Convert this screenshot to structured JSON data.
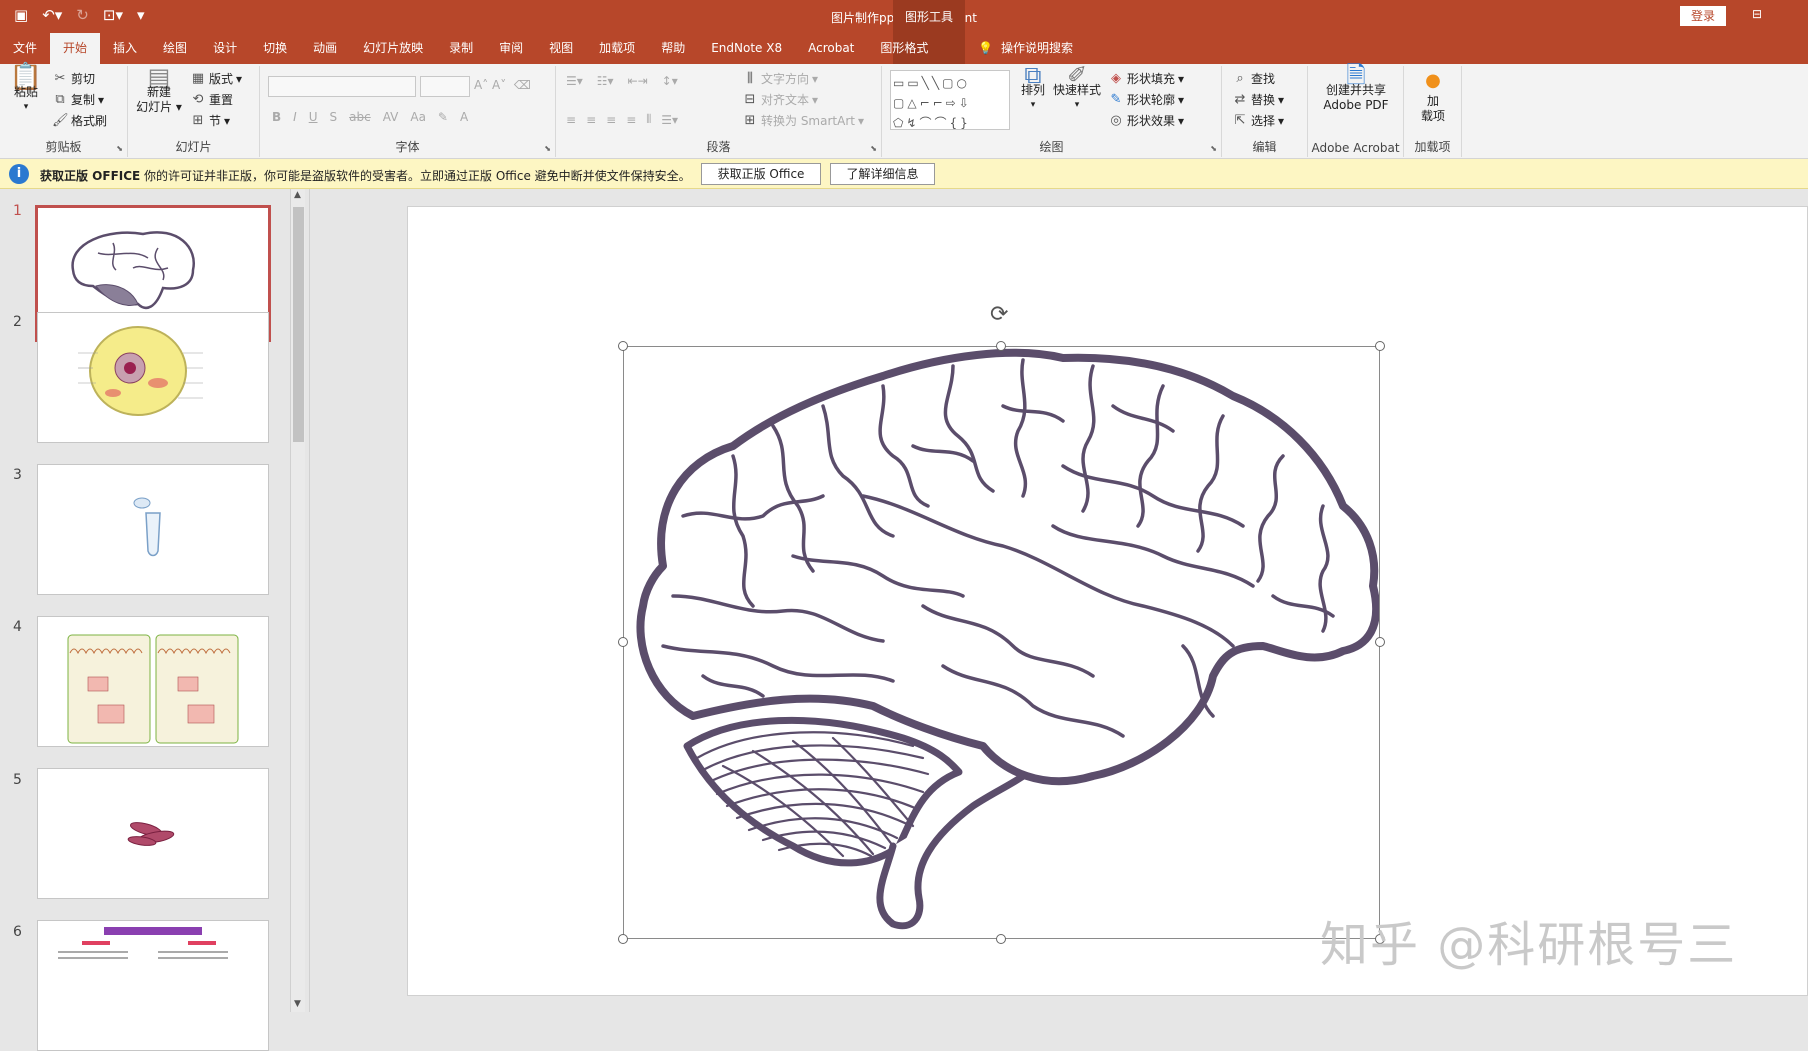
{
  "window": {
    "title": "图片制作ppt  -  PowerPoint",
    "context_tab_header": "图形工具",
    "login": "登录"
  },
  "qat": {
    "save_icon": "save-icon",
    "undo_icon": "undo-icon",
    "redo_icon": "redo-icon",
    "customize_icon": "customize-icon"
  },
  "tabs": [
    "文件",
    "开始",
    "插入",
    "绘图",
    "设计",
    "切换",
    "动画",
    "幻灯片放映",
    "录制",
    "审阅",
    "视图",
    "加载项",
    "帮助",
    "EndNote X8",
    "Acrobat",
    "图形格式"
  ],
  "active_tab": "开始",
  "tell_me": "操作说明搜索",
  "ribbon": {
    "clipboard": {
      "label": "剪贴板",
      "paste": "粘贴",
      "cut": "剪切",
      "copy": "复制",
      "format_painter": "格式刷"
    },
    "slides": {
      "label": "幻灯片",
      "new_slide_line1": "新建",
      "new_slide_line2": "幻灯片",
      "layout": "版式",
      "reset": "重置",
      "section": "节"
    },
    "font": {
      "label": "字体",
      "bold": "B",
      "italic": "I",
      "underline": "U",
      "shadow": "S",
      "strike": "abc",
      "spacing": "AV",
      "case": "Aa",
      "color": "A"
    },
    "paragraph": {
      "label": "段落",
      "text_direction": "文字方向",
      "align_text": "对齐文本",
      "smartart": "转换为 SmartArt"
    },
    "drawing": {
      "label": "绘图",
      "arrange": "排列",
      "quick_styles": "快速样式",
      "fill": "形状填充",
      "outline": "形状轮廓",
      "effects": "形状效果"
    },
    "editing": {
      "label": "编辑",
      "find": "查找",
      "replace": "替换",
      "select": "选择"
    },
    "acrobat": {
      "label": "Adobe Acrobat",
      "create_line1": "创建并共享",
      "create_line2": "Adobe PDF"
    },
    "addins": {
      "label": "加载项",
      "addin_line1": "加",
      "addin_line2": "载项"
    }
  },
  "notice": {
    "title": "获取正版 OFFICE",
    "text": "你的许可证并非正版，你可能是盗版软件的受害者。立即通过正版 Office 避免中断并使文件保持安全。",
    "button_genuine": "获取正版 Office",
    "button_learn": "了解详细信息"
  },
  "slides": [
    {
      "number": "1",
      "content": "brain"
    },
    {
      "number": "2",
      "content": "cell"
    },
    {
      "number": "3",
      "content": "tube"
    },
    {
      "number": "4",
      "content": "diagram"
    },
    {
      "number": "5",
      "content": "mitochondria"
    },
    {
      "number": "6",
      "content": "text"
    }
  ],
  "selected_slide": "1",
  "watermark": "知乎 @科研根号三",
  "colors": {
    "accent": "#b7472a",
    "brain_stroke": "#5b4d6b",
    "selection": "#c0504d"
  }
}
